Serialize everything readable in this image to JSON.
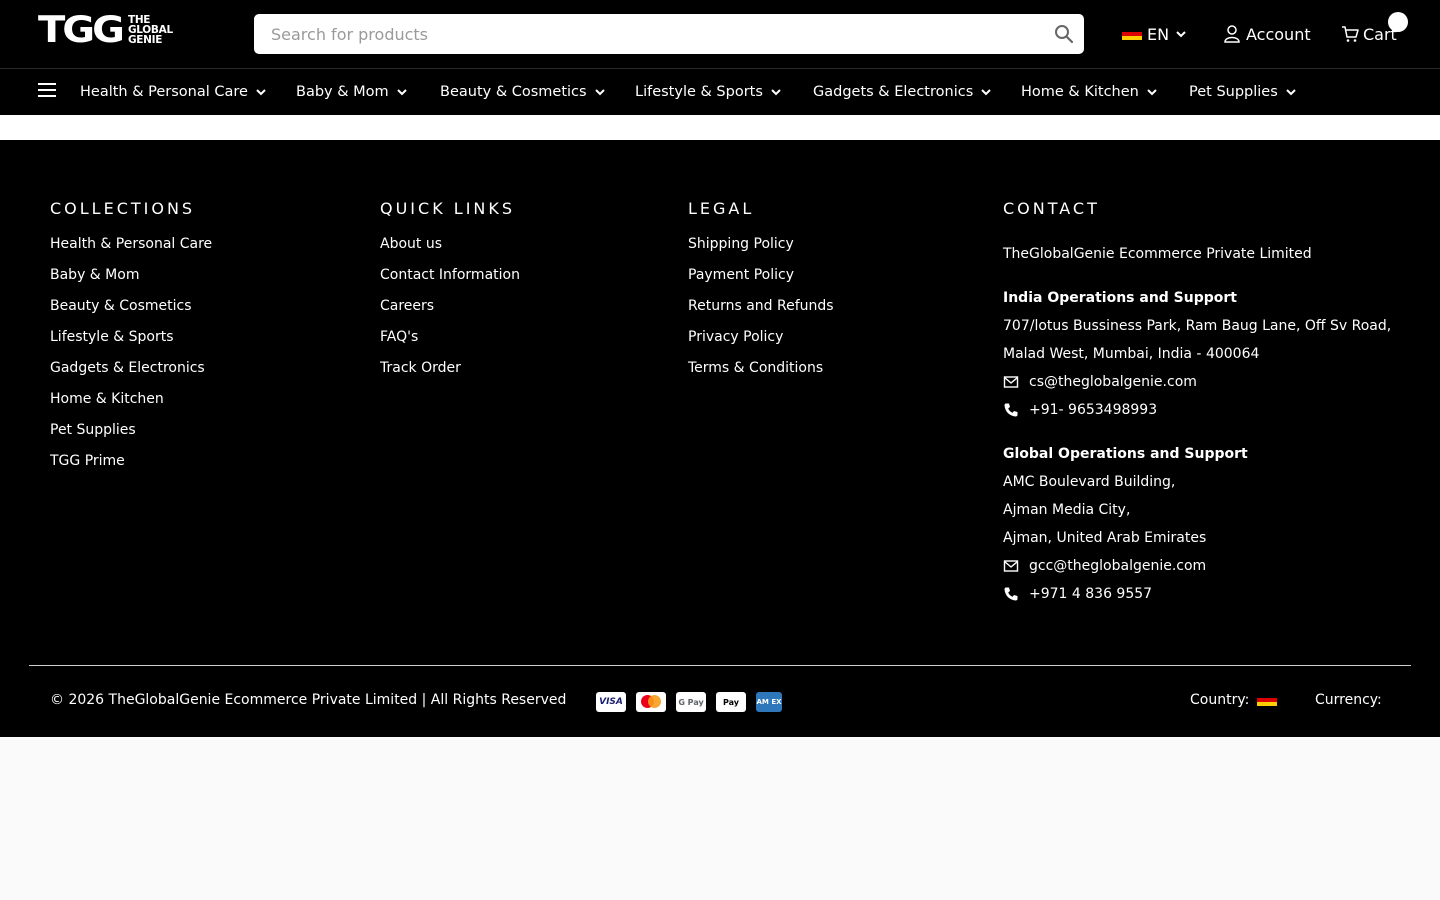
{
  "header": {
    "logo_big": "TGG",
    "logo_small": [
      "THE",
      "GLOBAL",
      "GENIE"
    ],
    "search_placeholder": "Search for products",
    "language": "EN",
    "account_label": "Account",
    "cart_label": "Cart"
  },
  "nav": {
    "items": [
      {
        "label": "Health & Personal Care"
      },
      {
        "label": "Baby & Mom"
      },
      {
        "label": "Beauty & Cosmetics"
      },
      {
        "label": "Lifestyle & Sports"
      },
      {
        "label": "Gadgets & Electronics"
      },
      {
        "label": "Home & Kitchen"
      },
      {
        "label": "Pet Supplies"
      }
    ]
  },
  "footer": {
    "collections": {
      "title": "COLLECTIONS",
      "links": [
        "Health & Personal Care",
        "Baby & Mom",
        "Beauty & Cosmetics",
        "Lifestyle & Sports",
        "Gadgets & Electronics",
        "Home & Kitchen",
        "Pet Supplies",
        "TGG Prime"
      ]
    },
    "quick_links": {
      "title": "QUICK LINKS",
      "links": [
        "About us",
        "Contact Information",
        "Careers",
        "FAQ's",
        "Track Order"
      ]
    },
    "legal": {
      "title": "LEGAL",
      "links": [
        "Shipping Policy",
        "Payment Policy",
        "Returns and Refunds",
        "Privacy Policy",
        "Terms & Conditions"
      ]
    },
    "contact": {
      "title": "CONTACT",
      "company": "TheGlobalGenie Ecommerce Private Limited",
      "india_title": "India Operations and Support",
      "india_address_1": "707/lotus Bussiness Park, Ram Baug Lane, Off Sv Road,",
      "india_address_2": "Malad West, Mumbai, India - 400064",
      "india_email": "cs@theglobalgenie.com",
      "india_phone": "+91- 9653498993",
      "global_title": "Global Operations and Support",
      "global_address_1": "AMC Boulevard Building,",
      "global_address_2": "Ajman Media City,",
      "global_address_3": "Ajman, United Arab Emirates",
      "global_email": "gcc@theglobalgenie.com",
      "global_phone": "+971 4 836 9557"
    },
    "copyright": "© 2026 TheGlobalGenie Ecommerce Private Limited | All Rights Reserved",
    "payments": {
      "visa": "VISA",
      "gpay": "G Pay",
      "apay": " Pay",
      "amex": "AM EX"
    },
    "country_label": "Country:",
    "currency_label": "Currency:"
  },
  "colors": {
    "header_bg": "#000000",
    "flag": [
      "#000000",
      "#dd0000",
      "#ffce00"
    ]
  }
}
